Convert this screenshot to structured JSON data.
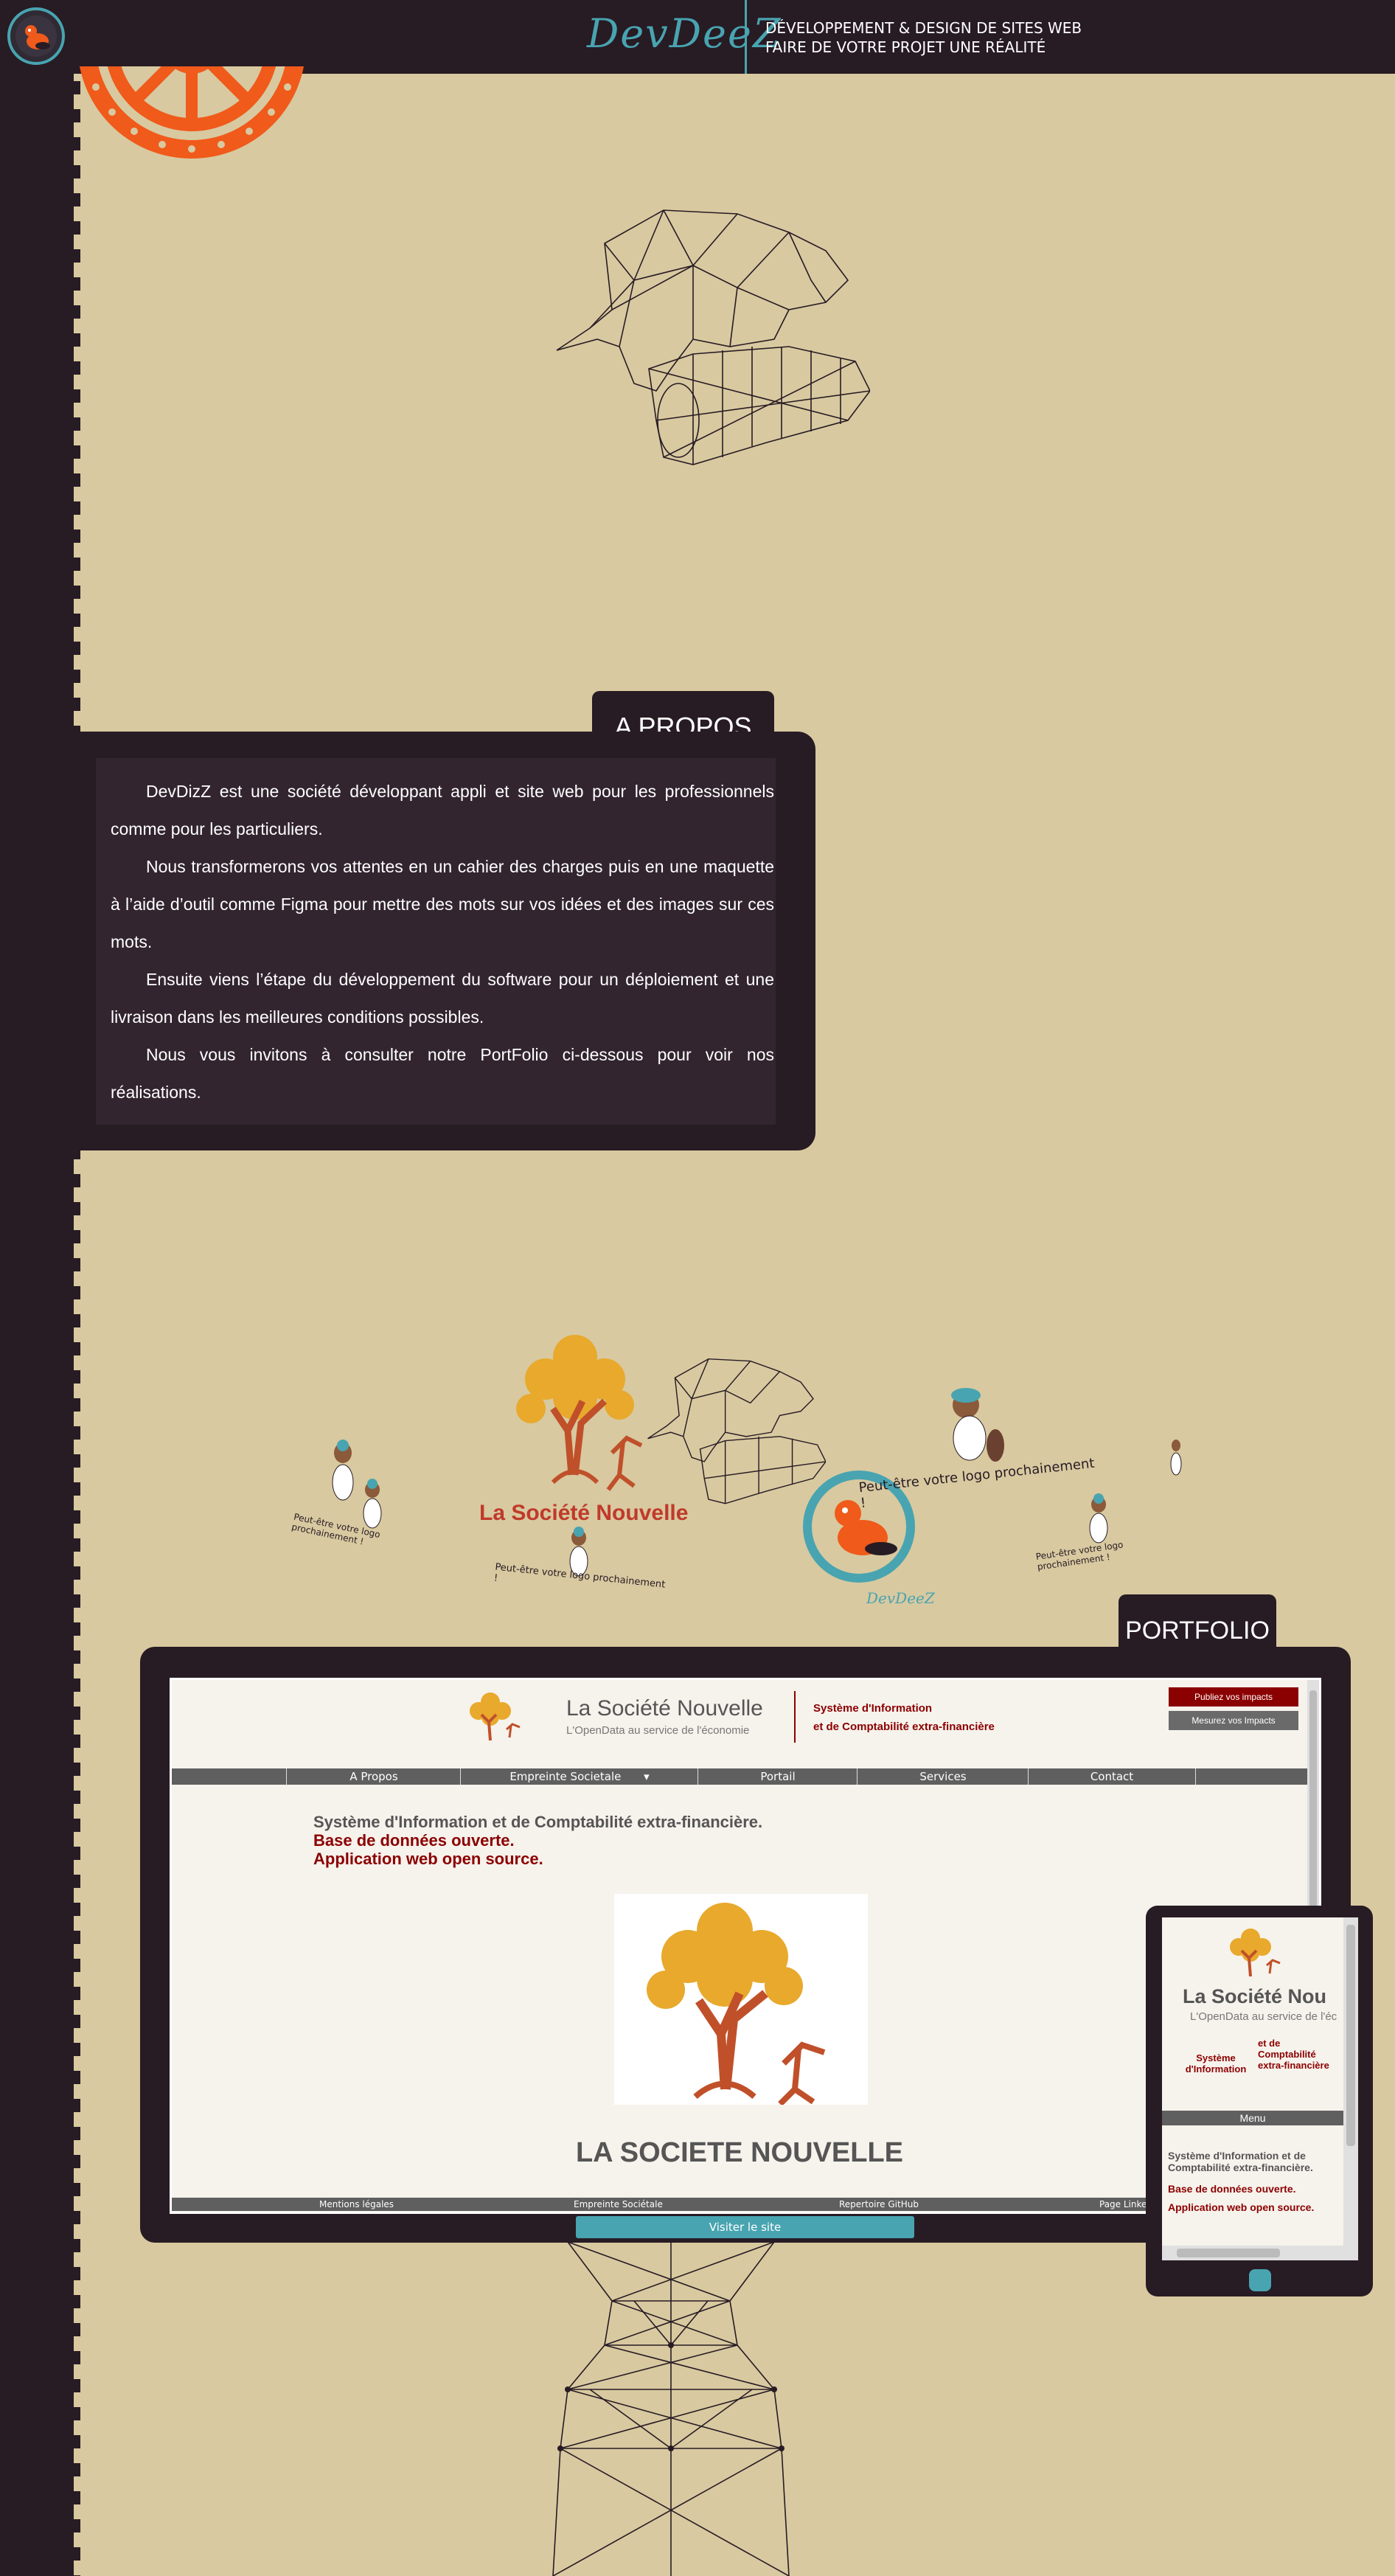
{
  "header": {
    "brand": "DevDeeZ",
    "tagline_line1": "DÉVELOPPEMENT & DESIGN DE SITES WEB",
    "tagline_line2": "FAIRE DE VOTRE PROJET UNE RÉALITÉ"
  },
  "about": {
    "title": "A PROPOS",
    "paragraphs": [
      "DevDizZ est une société développant appli et site web pour les professionnels comme pour les particuliers.",
      "Nous transformerons vos attentes en un cahier des charges puis en une maquette à l’aide d’outil comme Figma pour mettre des mots sur vos idées et des images sur ces mots.",
      "Ensuite viens l’étape du développement du software pour un déploiement et une livraison dans les meilleures conditions possibles.",
      "Nous vous invitons à consulter notre PortFolio ci-dessous pour voir nos réalisations."
    ]
  },
  "carousel": {
    "brand_logo_text": "La Société Nouvelle",
    "placeholder_text": "Peut-être votre logo prochainement !",
    "devdeez_logo_text": "DevDeeZ"
  },
  "portfolio": {
    "title": "PORTFOLIO",
    "visit_button": "Visiter le site",
    "site": {
      "name": "La Société Nouvelle",
      "subtitle": "L'OpenData au service de l'économie",
      "header_red_line1": "Système d'Information",
      "header_red_line2": "et de Comptabilité extra-financière",
      "btn_publish": "Publiez vos impacts",
      "btn_measure": "Mesurez vos Impacts",
      "nav": [
        "A Propos",
        "Empreinte Societale",
        "Portail",
        "Services",
        "Contact"
      ],
      "hero_line1": "Système d'Information et de Comptabilité extra-financière.",
      "hero_line2": "Base de données ouverte.",
      "hero_line3": "Application web open source.",
      "big_title": "LA SOCIETE NOUVELLE",
      "footer": [
        "Mentions légales",
        "Empreinte Sociétale",
        "Repertoire GitHub",
        "Page Linkedin"
      ]
    },
    "tablet_site": {
      "name": "La Société Nou",
      "subtitle": "L'OpenData au service de l'éc",
      "left_col": "Système d'Information",
      "right_col": "et de Comptabilité extra-financière",
      "menu": "Menu",
      "hero_line1": "Système d'Information et de Comptabilité extra-financière.",
      "hero_line2": "Base de données ouverte.",
      "hero_line3": "Application web open source."
    }
  },
  "colors": {
    "background": "#d8c9a0",
    "dark": "#271b24",
    "accent": "#48a4b0",
    "orange": "#f05a1a",
    "red": "#8b0000"
  }
}
